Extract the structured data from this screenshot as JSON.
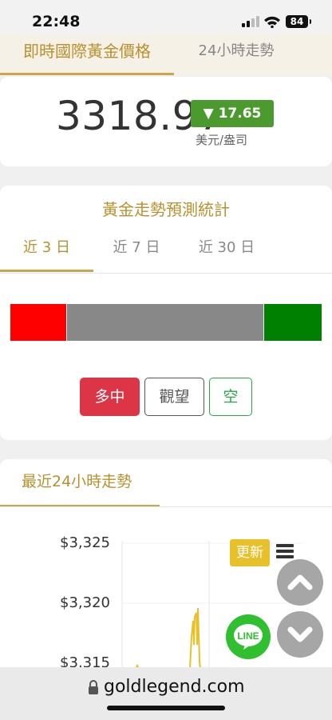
{
  "status_bar": {
    "time": "22:48",
    "battery": "84"
  },
  "top_tabs": {
    "active": "即時國際黃金價格",
    "inactive": "24小時走勢"
  },
  "price_card": {
    "price": "3318.97",
    "change": "▼ 17.65",
    "unit": "美元/盎司",
    "change_color": "#4a9a2e"
  },
  "prediction": {
    "title": "黃金走勢預測統計",
    "tabs": [
      {
        "label": "近 3 日",
        "active": true
      },
      {
        "label": "近 7 日"
      },
      {
        "label": "近 30 日"
      }
    ],
    "bar_segments": [
      {
        "color": "#ff0000",
        "share": 0.17
      },
      {
        "color": "#888888",
        "share": 0.61
      },
      {
        "color": "#008000",
        "share": 0.17
      }
    ],
    "buttons": {
      "long": "多中",
      "wait": "觀望",
      "short": "空"
    },
    "colors": {
      "long": "#dc3545",
      "short": "#28a745"
    }
  },
  "chart_section": {
    "title": "最近24小時走勢",
    "update_label": "更新",
    "y_ticks": [
      "$3,325",
      "$3,320",
      "$3,315"
    ],
    "menu_icon": "hamburger-icon"
  },
  "floating": {
    "up_icon": "chevron-up-icon",
    "down_icon": "chevron-down-icon",
    "line_label": "LINE"
  },
  "browser": {
    "url": "goldlegend.com"
  }
}
